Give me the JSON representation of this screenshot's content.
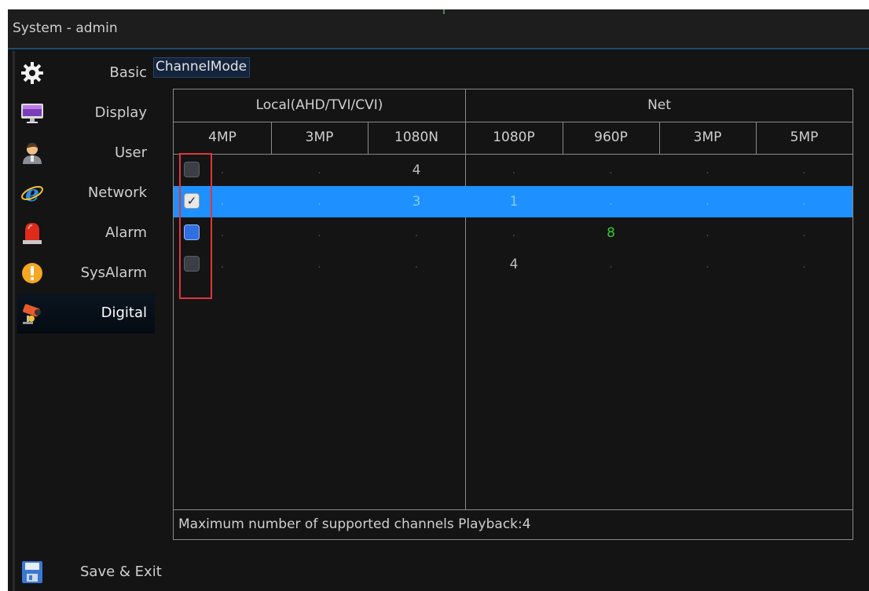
{
  "window": {
    "title": "System - admin"
  },
  "sidebar": {
    "items": [
      {
        "label": "Basic",
        "icon": "gear-icon"
      },
      {
        "label": "Display",
        "icon": "monitor-icon"
      },
      {
        "label": "User",
        "icon": "user-icon"
      },
      {
        "label": "Network",
        "icon": "internet-explorer-icon"
      },
      {
        "label": "Alarm",
        "icon": "alarm-siren-icon"
      },
      {
        "label": "SysAlarm",
        "icon": "warning-exclamation-icon"
      },
      {
        "label": "Digital",
        "icon": "camera-icon",
        "active": true
      }
    ],
    "save_exit": {
      "label": "Save & Exit",
      "icon": "floppy-disk-icon"
    }
  },
  "channel_mode": {
    "tab_label": "ChannelMode",
    "groups": [
      {
        "label": "Local(AHD/TVI/CVI)"
      },
      {
        "label": "Net"
      }
    ],
    "columns": [
      "4MP",
      "3MP",
      "1080N",
      "1080P",
      "960P",
      "3MP",
      "5MP"
    ],
    "rows": [
      {
        "checked": false,
        "state": "unchecked",
        "cells": [
          ".",
          ".",
          "4",
          ".",
          ".",
          ".",
          "."
        ]
      },
      {
        "checked": true,
        "state": "checked",
        "selected": true,
        "cells": [
          ".",
          ".",
          "3",
          "1",
          ".",
          ".",
          "."
        ]
      },
      {
        "checked": false,
        "state": "focused",
        "cells": [
          ".",
          ".",
          ".",
          ".",
          "8",
          ".",
          "."
        ]
      },
      {
        "checked": false,
        "state": "unchecked",
        "cells": [
          ".",
          ".",
          ".",
          "4",
          ".",
          ".",
          "."
        ]
      }
    ],
    "footer": "Maximum number of supported channels Playback:4"
  },
  "colors": {
    "selected_row": "#1e90ff",
    "highlight_value": "#34c934",
    "annotation_box": "#e0353d"
  }
}
